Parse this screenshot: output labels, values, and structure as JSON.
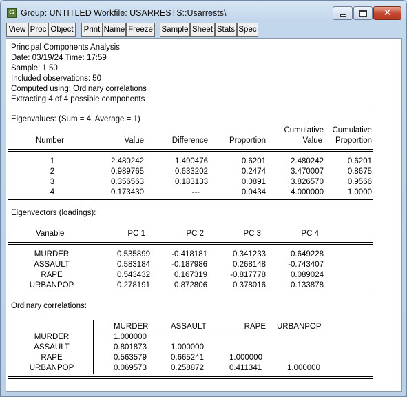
{
  "window": {
    "title": "Group: UNTITLED   Workfile: USARRESTS::Usarrests\\",
    "icon_letter": "G",
    "controls": [
      "minimize-icon",
      "maximize-icon",
      "close-icon"
    ],
    "close_glyph": "✕"
  },
  "toolbar": {
    "buttons": [
      "View",
      "Proc",
      "Object",
      "Print",
      "Name",
      "Freeze",
      "Sample",
      "Sheet",
      "Stats",
      "Spec"
    ]
  },
  "header": {
    "lines": [
      "Principal Components Analysis",
      "Date: 03/19/24   Time: 17:59",
      "Sample: 1 50",
      "Included observations: 50",
      "Computed using: Ordinary correlations",
      "Extracting 4 of 4 possible components"
    ]
  },
  "eigenvalues": {
    "title": "Eigenvalues: (Sum = 4, Average = 1)",
    "headers": {
      "number": "Number",
      "value": "Value",
      "difference": "Difference",
      "proportion": "Proportion",
      "cum_value_top": "Cumulative",
      "cum_value_bottom": "Value",
      "cum_prop_top": "Cumulative",
      "cum_prop_bottom": "Proportion"
    },
    "rows": [
      [
        "1",
        "2.480242",
        "1.490476",
        "0.6201",
        "2.480242",
        "0.6201"
      ],
      [
        "2",
        "0.989765",
        "0.633202",
        "0.2474",
        "3.470007",
        "0.8675"
      ],
      [
        "3",
        "0.356563",
        "0.183133",
        "0.0891",
        "3.826570",
        "0.9566"
      ],
      [
        "4",
        "0.173430",
        "---",
        "0.0434",
        "4.000000",
        "1.0000"
      ]
    ]
  },
  "eigenvectors": {
    "title": "Eigenvectors (loadings):",
    "headers": [
      "Variable",
      "PC 1",
      "PC 2",
      "PC 3",
      "PC 4"
    ],
    "rows": [
      [
        "MURDER",
        "0.535899",
        "-0.418181",
        "0.341233",
        "0.649228"
      ],
      [
        "ASSAULT",
        "0.583184",
        "-0.187986",
        "0.268148",
        "-0.743407"
      ],
      [
        "RAPE",
        "0.543432",
        "0.167319",
        "-0.817778",
        "0.089024"
      ],
      [
        "URBANPOP",
        "0.278191",
        "0.872806",
        "0.378016",
        "0.133878"
      ]
    ]
  },
  "correlations": {
    "title": "Ordinary correlations:",
    "headers": [
      "MURDER",
      "ASSAULT",
      "RAPE",
      "URBANPOP"
    ],
    "rows": [
      [
        "MURDER",
        "1.000000",
        "",
        "",
        ""
      ],
      [
        "ASSAULT",
        "0.801873",
        "1.000000",
        "",
        ""
      ],
      [
        "RAPE",
        "0.563579",
        "0.665241",
        "1.000000",
        ""
      ],
      [
        "URBANPOP",
        "0.069573",
        "0.258872",
        "0.411341",
        "1.000000"
      ]
    ]
  }
}
